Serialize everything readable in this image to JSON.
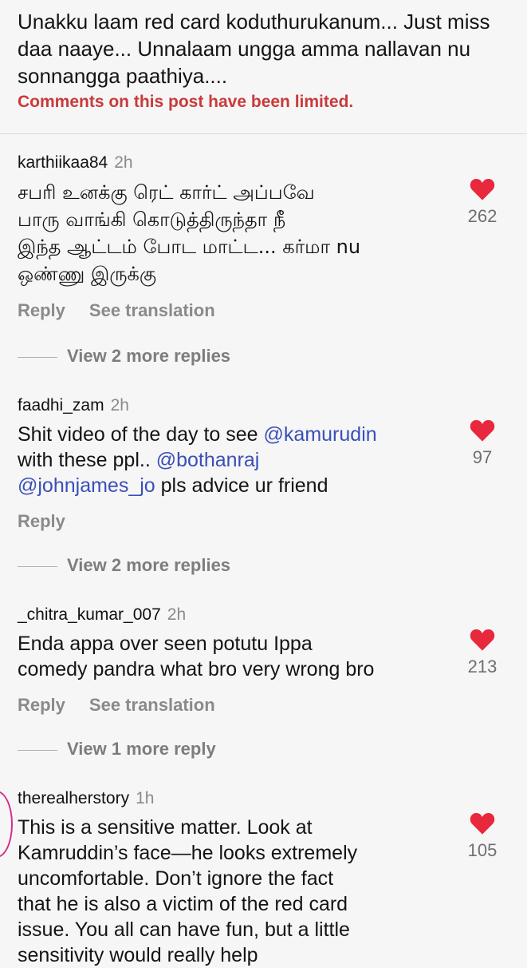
{
  "header_comment": {
    "text": "Unakku laam red card koduthurukanum... Just miss daa naaye... Unnalaam ungga amma nallavan nu sonnangga paathiya...."
  },
  "limited_notice": "Comments on this post have been limited.",
  "colors": {
    "heart": "#e8283c",
    "mention": "#3b4fb8",
    "notice": "#c93a3a"
  },
  "comments": [
    {
      "username": "karthiikaa84",
      "time": "2h",
      "lines": [
        "சபரி உனக்கு ரெட் கார்ட் அப்பவே",
        "பாரு வாங்கி கொடுத்திருந்தா நீ",
        "இந்த ஆட்டம் போட மாட்ட... கர்மா nu",
        "ஒண்ணு இருக்கு"
      ],
      "likes": "262",
      "reply": "Reply",
      "translate": "See translation",
      "view_more": "View 2 more replies"
    },
    {
      "username": "faadhi_zam",
      "time": "2h",
      "part1": "Shit video of the day to see ",
      "mention1": "@kamurudin",
      "part2": "with these ppl.. ",
      "mention2": "@bothanraj",
      "mention3": "@johnjames_jo",
      "part3": " pls advice ur friend",
      "likes": "97",
      "reply": "Reply",
      "view_more": "View 2 more replies"
    },
    {
      "username": "_chitra_kumar_007",
      "time": "2h",
      "lines": [
        "Enda appa over seen potutu Ippa",
        "comedy pandra what bro very wrong bro"
      ],
      "likes": "213",
      "reply": "Reply",
      "translate": "See translation",
      "view_more": "View 1 more reply"
    },
    {
      "username": "therealherstory",
      "time": "1h",
      "lines": [
        "This is a sensitive matter. Look at",
        "Kamruddin’s face—he looks extremely",
        "uncomfortable. Don’t ignore the fact",
        "that he is also a victim of the red card",
        "issue. You all can have fun, but a little",
        "sensitivity would really help"
      ],
      "likes": "105"
    }
  ]
}
